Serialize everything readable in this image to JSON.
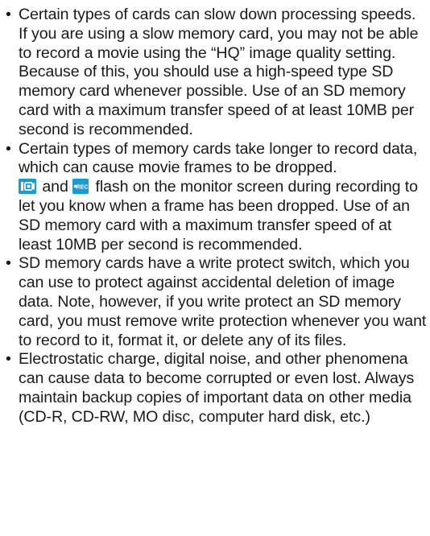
{
  "bullets": [
    {
      "text": "Certain types of cards can slow down processing speeds. If you are using a slow memory card, you may not be able to record a movie using the “HQ” image quality setting. Because of this, you should use a high-speed type SD memory card whenever possible. Use of an SD memory card with a maximum transfer speed of at least 10MB per second is recommended."
    },
    {
      "text_before_icons": "Certain types of memory cards take longer to record data, which can cause movie frames to be dropped.",
      "icon1": "movie-mode-icon",
      "between_icons": "and",
      "icon2": "rec-icon",
      "icon2_label": "●REC",
      "text_after_icons": "flash on the monitor screen during recording to let you know when a frame has been dropped. Use of an SD memory card with a maximum transfer speed of at least 10MB per second is recommended."
    },
    {
      "text": "SD memory cards have a write protect switch, which you can use to protect against accidental deletion of image data. Note, however, if you write protect an SD memory card, you must remove write protection whenever you want to record to it, format it, or delete any of its files."
    },
    {
      "text": "Electrostatic charge, digital noise, and other phenomena can cause data to become corrupted or even lost. Always maintain backup copies of important data on other media (CD-R, CD-RW, MO disc, computer hard disk, etc.)"
    }
  ],
  "bullet_char": "•",
  "colors": {
    "text": "#1a1a1a",
    "icon": "#1d9ad6"
  }
}
